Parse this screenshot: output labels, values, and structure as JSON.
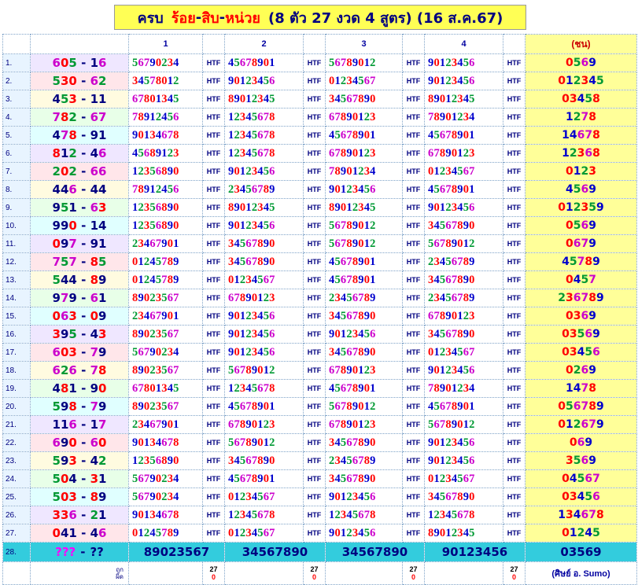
{
  "title": {
    "part1": "ครบ",
    "part2": "ร้อย",
    "part3": "สิบ",
    "part4": "หน่วย",
    "detail": "(8 ตัว 27 งวด 4 สูตร) (16 ส.ค.67)"
  },
  "headers": [
    "1",
    "2",
    "3",
    "4"
  ],
  "result_header": "(ชน)",
  "htf_label": "HTF",
  "rows": [
    {
      "num": "1.",
      "pair": "605 - 16",
      "cols": [
        "56790234",
        "45678901",
        "56789012",
        "90123456"
      ],
      "res": "0569"
    },
    {
      "num": "2.",
      "pair": "530 - 62",
      "cols": [
        "34578012",
        "90123456",
        "01234567",
        "90123456"
      ],
      "res": "012345"
    },
    {
      "num": "3.",
      "pair": "453 - 11",
      "cols": [
        "67801345",
        "89012345",
        "34567890",
        "89012345"
      ],
      "res": "03458"
    },
    {
      "num": "4.",
      "pair": "782 - 67",
      "cols": [
        "78912456",
        "12345678",
        "67890123",
        "78901234"
      ],
      "res": "1278"
    },
    {
      "num": "5.",
      "pair": "478 - 91",
      "cols": [
        "90134678",
        "12345678",
        "45678901",
        "45678901"
      ],
      "res": "14678"
    },
    {
      "num": "6.",
      "pair": "812 - 46",
      "cols": [
        "45689123",
        "12345678",
        "67890123",
        "67890123"
      ],
      "res": "12368"
    },
    {
      "num": "7.",
      "pair": "202 - 66",
      "cols": [
        "12356890",
        "90123456",
        "78901234",
        "01234567"
      ],
      "res": "0123"
    },
    {
      "num": "8.",
      "pair": "446 - 44",
      "cols": [
        "78912456",
        "23456789",
        "90123456",
        "45678901"
      ],
      "res": "4569"
    },
    {
      "num": "9.",
      "pair": "951 - 63",
      "cols": [
        "12356890",
        "89012345",
        "89012345",
        "90123456"
      ],
      "res": "012359"
    },
    {
      "num": "10.",
      "pair": "990 - 14",
      "cols": [
        "12356890",
        "90123456",
        "56789012",
        "34567890"
      ],
      "res": "0569"
    },
    {
      "num": "11.",
      "pair": "097 - 91",
      "cols": [
        "23467901",
        "34567890",
        "56789012",
        "56789012"
      ],
      "res": "0679"
    },
    {
      "num": "12.",
      "pair": "757 - 85",
      "cols": [
        "01245789",
        "34567890",
        "45678901",
        "23456789"
      ],
      "res": "45789"
    },
    {
      "num": "13.",
      "pair": "544 - 89",
      "cols": [
        "01245789",
        "01234567",
        "45678901",
        "34567890"
      ],
      "res": "0457"
    },
    {
      "num": "14.",
      "pair": "979 - 61",
      "cols": [
        "89023567",
        "67890123",
        "23456789",
        "23456789"
      ],
      "res": "236789"
    },
    {
      "num": "15.",
      "pair": "063 - 09",
      "cols": [
        "23467901",
        "90123456",
        "34567890",
        "67890123"
      ],
      "res": "0369"
    },
    {
      "num": "16.",
      "pair": "395 - 43",
      "cols": [
        "89023567",
        "90123456",
        "90123456",
        "34567890"
      ],
      "res": "03569"
    },
    {
      "num": "17.",
      "pair": "603 - 79",
      "cols": [
        "56790234",
        "90123456",
        "34567890",
        "01234567"
      ],
      "res": "03456"
    },
    {
      "num": "18.",
      "pair": "626 - 78",
      "cols": [
        "89023567",
        "56789012",
        "67890123",
        "90123456"
      ],
      "res": "0269"
    },
    {
      "num": "19.",
      "pair": "481 - 90",
      "cols": [
        "67801345",
        "12345678",
        "45678901",
        "78901234"
      ],
      "res": "1478"
    },
    {
      "num": "20.",
      "pair": "598 - 79",
      "cols": [
        "89023567",
        "45678901",
        "56789012",
        "45678901"
      ],
      "res": "056789"
    },
    {
      "num": "21.",
      "pair": "116 - 17",
      "cols": [
        "23467901",
        "67890123",
        "67890123",
        "56789012"
      ],
      "res": "012679"
    },
    {
      "num": "22.",
      "pair": "690 - 60",
      "cols": [
        "90134678",
        "56789012",
        "34567890",
        "90123456"
      ],
      "res": "069"
    },
    {
      "num": "23.",
      "pair": "593 - 42",
      "cols": [
        "12356890",
        "34567890",
        "23456789",
        "90123456"
      ],
      "res": "3569"
    },
    {
      "num": "24.",
      "pair": "504 - 31",
      "cols": [
        "56790234",
        "45678901",
        "34567890",
        "01234567"
      ],
      "res": "04567"
    },
    {
      "num": "25.",
      "pair": "503 - 89",
      "cols": [
        "56790234",
        "01234567",
        "90123456",
        "34567890"
      ],
      "res": "03456"
    },
    {
      "num": "26.",
      "pair": "336 - 21",
      "cols": [
        "90134678",
        "12345678",
        "12345678",
        "12345678"
      ],
      "res": "134678"
    },
    {
      "num": "27.",
      "pair": "041 - 46",
      "cols": [
        "01245789",
        "01234567",
        "90123456",
        "89012345"
      ],
      "res": "01245"
    }
  ],
  "last_row": {
    "num": "28.",
    "pair_q": "???",
    "pair_sep": "-",
    "pair_q2": "??",
    "cols": [
      "89023567",
      "34567890",
      "34567890",
      "90123456"
    ],
    "res": "03569"
  },
  "footer": {
    "label_line1": "ถูก",
    "label_line2": "ผิด",
    "counts": [
      {
        "hit": "27",
        "miss": "0"
      },
      {
        "hit": "27",
        "miss": "0"
      },
      {
        "hit": "27",
        "miss": "0"
      },
      {
        "hit": "27",
        "miss": "0"
      }
    ],
    "credit": "(ศิษย์ อ. Sumo)"
  },
  "colors": {
    "title_bg": "#ffff55",
    "title_text": "#000080",
    "title_red": "#ff0000",
    "result_bg": "#ffff99",
    "last_row_bg": "#33ccdd",
    "digit_colors": [
      "#ff0000",
      "#0000cc",
      "#009933",
      "#cc00cc",
      "#000000"
    ],
    "pair_row_bgs": [
      "#efe7ff",
      "#ffe6ea",
      "#fffbe0",
      "#e8ffe8",
      "#e0ffff"
    ]
  }
}
